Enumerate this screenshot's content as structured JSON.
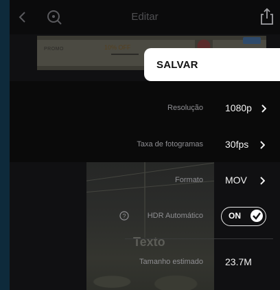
{
  "topbar": {
    "title": "Editar",
    "back_icon": "chevron-left-icon",
    "zoom_icon": "magnify-icon",
    "share_icon": "share-icon"
  },
  "banner": {
    "left_text": "PROMO",
    "mid_text": "10% OFF",
    "badge_text": "-15"
  },
  "save": {
    "label": "SALVAR"
  },
  "settings": {
    "resolution": {
      "label": "Resolução",
      "value": "1080p"
    },
    "frame_rate": {
      "label": "Taxa de fotogramas",
      "value": "30fps"
    },
    "format": {
      "label": "Formato",
      "value": "MOV"
    },
    "hdr": {
      "label": "HDR Automático",
      "toggle_text": "ON",
      "enabled": true
    },
    "size": {
      "label": "Tamanho estimado",
      "value": "23.7M"
    }
  },
  "preview": {
    "overlay_text": "Texto"
  },
  "colors": {
    "background": "#0e2a3b",
    "panel": "#101012",
    "save_panel": "#ffffff",
    "label": "#8f8f93",
    "value": "#f2f2f2"
  }
}
